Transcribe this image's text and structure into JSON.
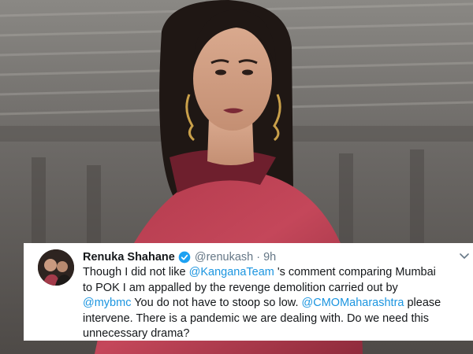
{
  "tweet": {
    "display_name": "Renuka Shahane",
    "handle": "@renukash",
    "separator": "·",
    "timestamp": "9h",
    "verified": true,
    "body_lines": [
      [
        {
          "text": "Though I did not like ",
          "mention": false
        },
        {
          "text": "@KanganaTeam",
          "mention": true
        },
        {
          "text": " 's comment comparing Mumbai",
          "mention": false
        }
      ],
      [
        {
          "text": "to POK I am appalled by the revenge demolition carried out by",
          "mention": false
        }
      ],
      [
        {
          "text": "@mybmc",
          "mention": true
        },
        {
          "text": " You do not have to stoop so low. ",
          "mention": false
        },
        {
          "text": "@CMOMaharashtra",
          "mention": true
        },
        {
          "text": " please",
          "mention": false
        }
      ],
      [
        {
          "text": "intervene. There is a pandemic we are dealing with. Do we need this",
          "mention": false
        }
      ],
      [
        {
          "text": "unnecessary drama?",
          "mention": false
        }
      ]
    ]
  },
  "colors": {
    "mention": "#1b95e0",
    "verified_badge": "#1da1f2",
    "text_primary": "#14171a",
    "text_secondary": "#657786",
    "card_background": "#ffffff"
  },
  "icons": {
    "verified": "verified-badge-icon",
    "more": "chevron-down-icon",
    "avatar": "profile-avatar"
  }
}
